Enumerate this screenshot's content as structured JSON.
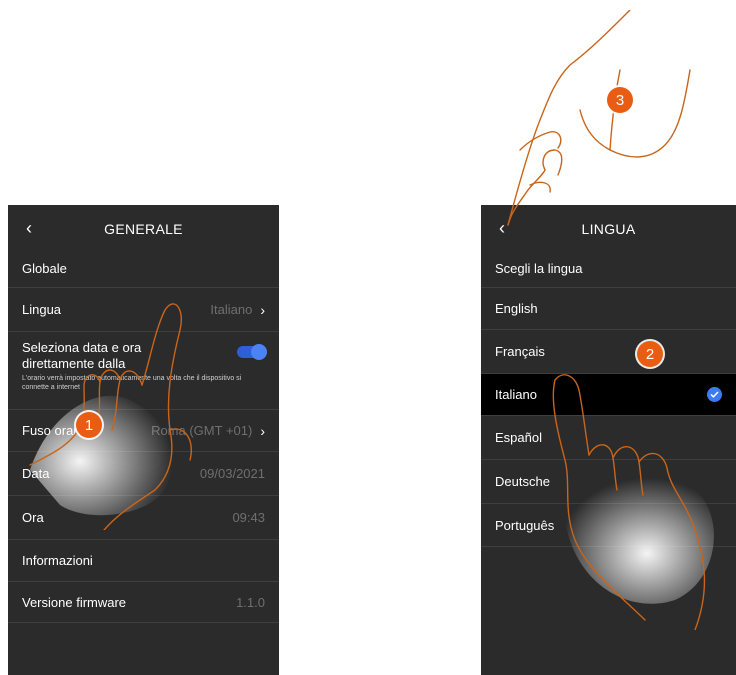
{
  "left_screen": {
    "title": "GENERALE",
    "section": "Globale",
    "rows": {
      "lingua": {
        "label": "Lingua",
        "value": "Italiano"
      },
      "data_ora": {
        "label": "Seleziona data e ora direttamente dalla",
        "note": "L'orario verrà impostato automaticamente una volta che il dispositivo si connette a internet"
      },
      "fuso": {
        "label": "Fuso orario",
        "value": "Roma (GMT +01)"
      },
      "data": {
        "label": "Data",
        "value": "09/03/2021"
      },
      "ora": {
        "label": "Ora",
        "value": "09:43"
      },
      "informazioni": {
        "label": "Informazioni"
      },
      "firmware": {
        "label": "Versione firmware",
        "value": "1.1.0"
      }
    }
  },
  "right_screen": {
    "title": "LINGUA",
    "section": "Scegli la lingua",
    "languages": [
      "English",
      "Français",
      "Italiano",
      "Español",
      "Deutsche",
      "Português"
    ],
    "selected": "Italiano"
  },
  "steps": {
    "one": "1",
    "two": "2",
    "three": "3"
  },
  "colors": {
    "screen_bg": "#2b2b2b",
    "accent": "#3d7bf5",
    "badge": "#e85d13",
    "hand_outline": "#c9651b"
  },
  "icons": {
    "back": "chevron-left-icon",
    "chevron": "chevron-right-icon",
    "check": "check-circle-icon",
    "toggle": "toggle-switch"
  }
}
